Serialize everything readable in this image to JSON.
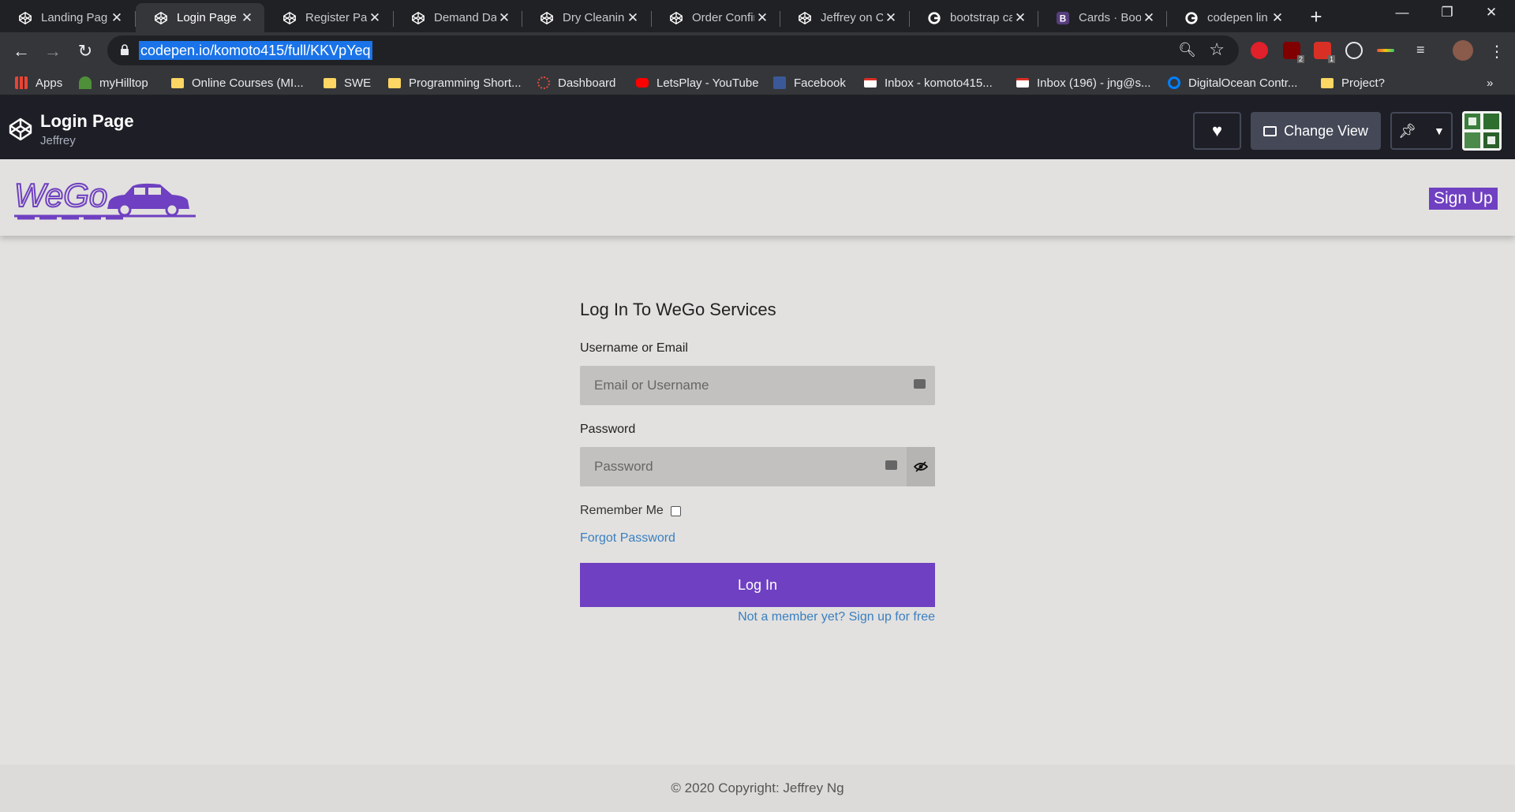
{
  "browser": {
    "tabs": [
      {
        "title": "Landing Pag",
        "favicon": "codepen-icon",
        "active": false
      },
      {
        "title": "Login Page",
        "favicon": "codepen-icon",
        "active": true
      },
      {
        "title": "Register Pag",
        "favicon": "codepen-icon",
        "active": false
      },
      {
        "title": "Demand Dat",
        "favicon": "codepen-icon",
        "active": false
      },
      {
        "title": "Dry Cleaning",
        "favicon": "codepen-icon",
        "active": false
      },
      {
        "title": "Order Confir",
        "favicon": "codepen-icon",
        "active": false
      },
      {
        "title": "Jeffrey on C",
        "favicon": "codepen-icon",
        "active": false
      },
      {
        "title": "bootstrap ca",
        "favicon": "google-icon",
        "active": false
      },
      {
        "title": "Cards · Boot",
        "favicon": "bootstrap-icon",
        "active": false
      },
      {
        "title": "codepen lin",
        "favicon": "google-icon",
        "active": false
      }
    ],
    "url": "codepen.io/komoto415/full/KKVpYeq",
    "bookmarks": [
      {
        "label": "Apps",
        "icon": "apps-grid-icon"
      },
      {
        "label": "myHilltop",
        "icon": "hilltop-icon"
      },
      {
        "label": "Online Courses (MI...",
        "icon": "folder-icon"
      },
      {
        "label": "SWE",
        "icon": "folder-icon"
      },
      {
        "label": "Programming Short...",
        "icon": "folder-icon"
      },
      {
        "label": "Dashboard",
        "icon": "dashboard-icon"
      },
      {
        "label": "LetsPlay - YouTube",
        "icon": "youtube-icon"
      },
      {
        "label": "Facebook",
        "icon": "facebook-icon"
      },
      {
        "label": "Inbox - komoto415...",
        "icon": "gmail-icon"
      },
      {
        "label": "Inbox (196) - jng@s...",
        "icon": "gmail-icon"
      },
      {
        "label": "DigitalOcean Contr...",
        "icon": "digitalocean-icon"
      },
      {
        "label": "Project?",
        "icon": "folder-icon"
      }
    ],
    "extension_badges": {
      "ublock": "2",
      "ext2": "1"
    }
  },
  "codepen": {
    "title": "Login Page",
    "user": "Jeffrey",
    "change_view_label": "Change View"
  },
  "nav": {
    "brand": "WeGo",
    "signup_label": "Sign Up"
  },
  "login": {
    "heading": "Log In To WeGo Services",
    "username_label": "Username or Email",
    "username_placeholder": "Email or Username",
    "password_label": "Password",
    "password_placeholder": "Password",
    "remember_label": "Remember Me",
    "forgot_label": "Forgot Password",
    "submit_label": "Log In",
    "signup_prompt": "Not a member yet? Sign up for free"
  },
  "footer": {
    "copyright": "© 2020 Copyright: Jeffrey Ng"
  },
  "colors": {
    "accent": "#6f40c1",
    "link": "#3a7fc1",
    "page_bg": "#e2e1df",
    "codepen_bar": "#1e1f26"
  }
}
